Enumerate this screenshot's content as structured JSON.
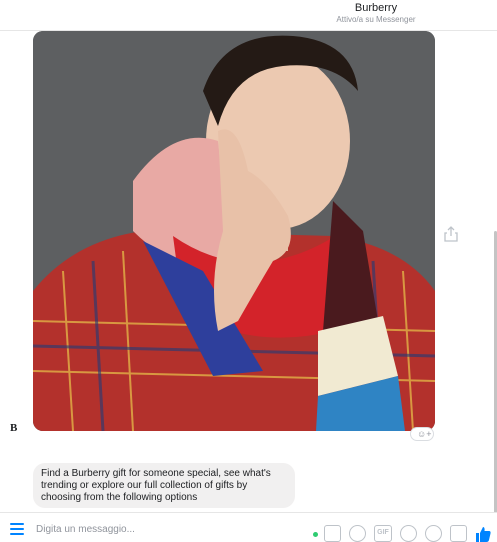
{
  "header": {
    "title": "Burberry",
    "subtitle": "Attivo/a su Messenger"
  },
  "sender": {
    "avatar_letter": "B"
  },
  "message": {
    "text": "Find a Burberry gift for someone special, see what's trending or explore our full collection of gifts by choosing from the following options"
  },
  "composer": {
    "placeholder": "Digita un messaggio...",
    "gif_label": "GIF"
  },
  "icons": {
    "menu": "menu-icon",
    "share": "share-icon",
    "reaction": "smiley-reaction-icon",
    "like": "thumbs-up-icon"
  },
  "colors": {
    "accent": "#0084ff",
    "online": "#2ecc71",
    "bubble": "#f1f0f0"
  }
}
